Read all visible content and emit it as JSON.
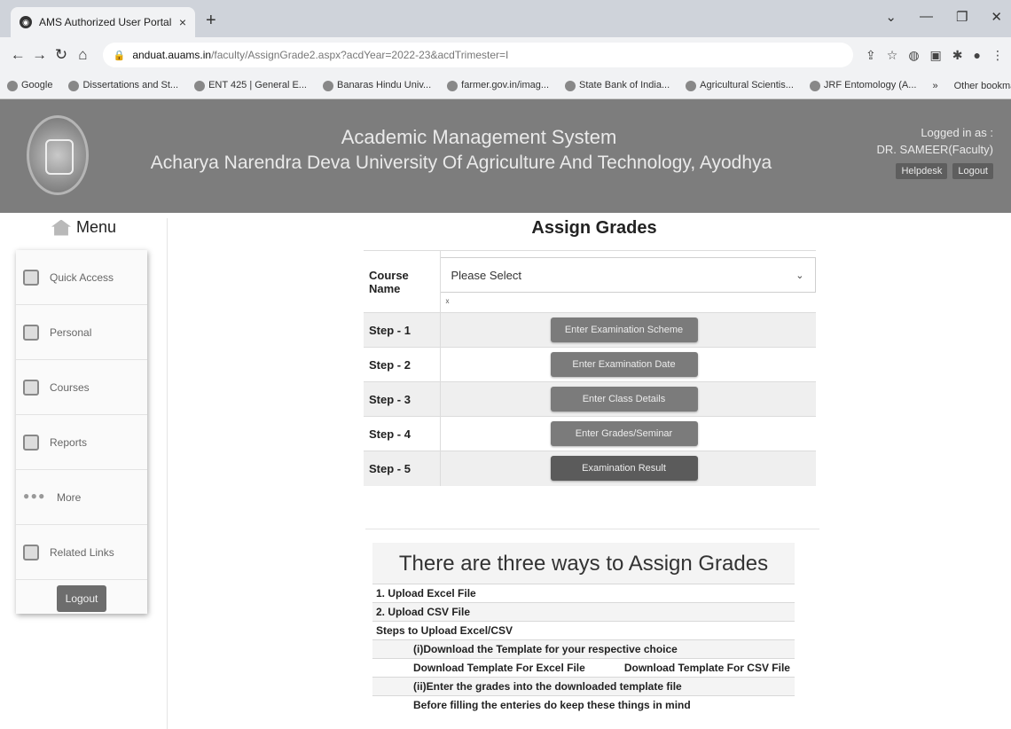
{
  "browser": {
    "tab_title": "AMS Authorized User Portal",
    "tab_close": "×",
    "new_tab": "+",
    "url_host": "anduat.auams.in",
    "url_path": "/faculty/AssignGrade2.aspx?acdYear=2022-23&acdTrimester=I",
    "bookmarks": [
      "Google",
      "Dissertations and St...",
      "ENT 425 | General E...",
      "Banaras Hindu Univ...",
      "farmer.gov.in/imag...",
      "State Bank of India...",
      "Agricultural Scientis...",
      "JRF Entomology (A..."
    ],
    "bookmarks_more": "»",
    "other_bookmarks": "Other bookmarks"
  },
  "header": {
    "title": "Academic Management System",
    "university": "Acharya Narendra Deva University Of Agriculture And Technology, Ayodhya",
    "logged_in_label": "Logged in as :",
    "user": "DR. SAMEER(Faculty)",
    "helpdesk": "Helpdesk",
    "logout": "Logout"
  },
  "sidebar": {
    "title": "Menu",
    "items": [
      {
        "label": "Quick Access"
      },
      {
        "label": "Personal"
      },
      {
        "label": "Courses"
      },
      {
        "label": "Reports"
      },
      {
        "label": "More"
      },
      {
        "label": "Related Links"
      }
    ],
    "logout": "Logout"
  },
  "main": {
    "title": "Assign Grades",
    "course_label": "Course Name",
    "course_select": "Please Select",
    "course_note": "x",
    "steps": [
      {
        "label": "Step - 1",
        "button": "Enter Examination Scheme"
      },
      {
        "label": "Step - 2",
        "button": "Enter Examination Date"
      },
      {
        "label": "Step - 3",
        "button": "Enter Class Details"
      },
      {
        "label": "Step - 4",
        "button": "Enter Grades/Seminar"
      },
      {
        "label": "Step - 5",
        "button": "Examination Result"
      }
    ]
  },
  "ways": {
    "title": "There are three ways to Assign Grades",
    "line1": "1. Upload Excel File",
    "line2": "2. Upload CSV File",
    "line3": "Steps to Upload Excel/CSV",
    "line4": "(i)Download the Template for your respective choice",
    "dl_excel": "Download Template For Excel File",
    "dl_csv": "Download Template For CSV File",
    "line5": "(ii)Enter the grades into the downloaded template file",
    "line6": "Before filling the enteries do keep these things in mind"
  }
}
